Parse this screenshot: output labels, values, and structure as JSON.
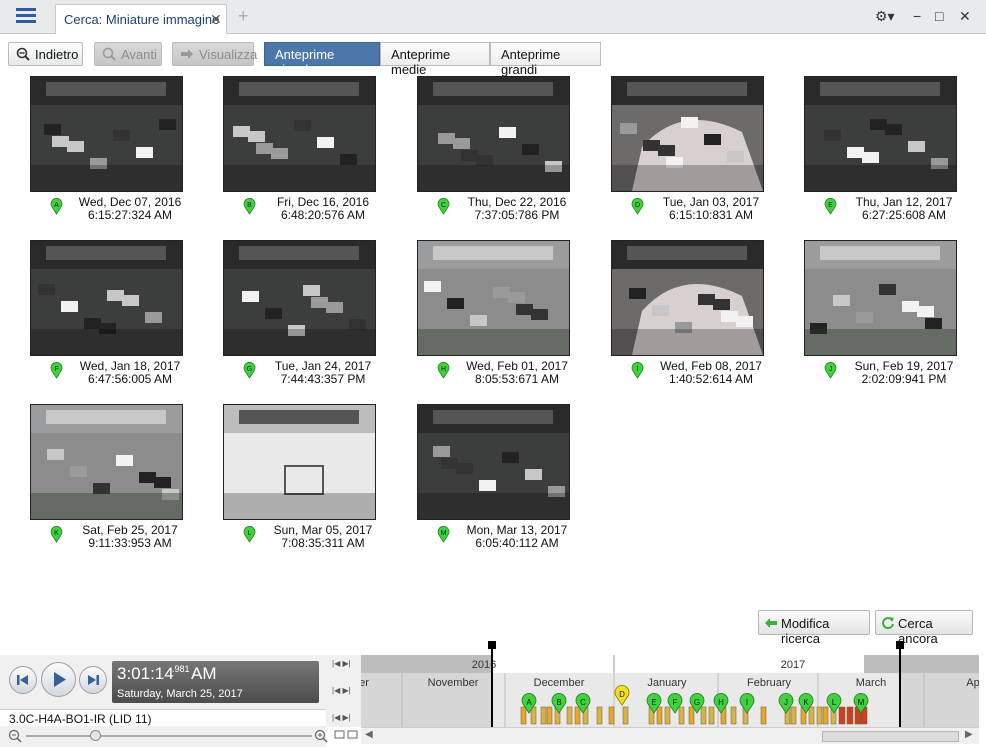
{
  "header": {
    "tab_title": "Cerca: Miniature immagine",
    "close": "✕",
    "add": "+"
  },
  "window": {
    "settings": "⚙▾",
    "minimize": "−",
    "maximize": "□",
    "close": "✕"
  },
  "toolbar": {
    "back": "Indietro",
    "forward": "Avanti",
    "view": "Visualizza",
    "sizes": [
      "Anteprime piccole",
      "Anteprime medie",
      "Anteprime grandi"
    ],
    "active_size": 0
  },
  "thumbnails": [
    {
      "letter": "A",
      "date": "Wed, Dec 07, 2016",
      "time": "6:15:27:324 AM",
      "scene": "night"
    },
    {
      "letter": "B",
      "date": "Fri, Dec 16, 2016",
      "time": "6:48:20:576 AM",
      "scene": "night"
    },
    {
      "letter": "C",
      "date": "Thu, Dec 22, 2016",
      "time": "7:37:05:786 PM",
      "scene": "night"
    },
    {
      "letter": "D",
      "date": "Tue, Jan 03, 2017",
      "time": "6:15:10:831 AM",
      "scene": "snowpile"
    },
    {
      "letter": "E",
      "date": "Thu, Jan 12, 2017",
      "time": "6:27:25:608 AM",
      "scene": "night"
    },
    {
      "letter": "F",
      "date": "Wed, Jan 18, 2017",
      "time": "6:47:56:005 AM",
      "scene": "night"
    },
    {
      "letter": "G",
      "date": "Tue, Jan 24, 2017",
      "time": "7:44:43:357 PM",
      "scene": "night"
    },
    {
      "letter": "H",
      "date": "Wed, Feb 01, 2017",
      "time": "8:05:53:671 AM",
      "scene": "day"
    },
    {
      "letter": "I",
      "date": "Wed, Feb 08, 2017",
      "time": "1:40:52:614 AM",
      "scene": "snowpile"
    },
    {
      "letter": "J",
      "date": "Sun, Feb 19, 2017",
      "time": "2:02:09:941 PM",
      "scene": "day"
    },
    {
      "letter": "K",
      "date": "Sat, Feb 25, 2017",
      "time": "9:11:33:953 AM",
      "scene": "day"
    },
    {
      "letter": "L",
      "date": "Sun, Mar 05, 2017",
      "time": "7:08:35:311 AM",
      "scene": "snow"
    },
    {
      "letter": "M",
      "date": "Mon, Mar 13, 2017",
      "time": "6:05:40:112 AM",
      "scene": "night"
    }
  ],
  "actions": {
    "modify": "Modifica ricerca",
    "search_again": "Cerca ancora"
  },
  "player": {
    "time": "3:01:14",
    "ms": ".981",
    "ampm": "AM",
    "date": "Saturday, March 25, 2017",
    "camera": "3.0C-H4A-BO1-IR (LID 11)"
  },
  "timeline": {
    "years": [
      "2016",
      "2017"
    ],
    "months": [
      "ber",
      "November",
      "December",
      "January",
      "February",
      "March",
      "Ap"
    ],
    "markers": [
      "A",
      "B",
      "C",
      "D",
      "E",
      "F",
      "G",
      "H",
      "I",
      "J",
      "K",
      "L",
      "M"
    ],
    "selected_marker": "D"
  },
  "colors": {
    "accent": "#4b77aa",
    "marker_green": "#3fd23a",
    "marker_yellow": "#f3df1c"
  }
}
